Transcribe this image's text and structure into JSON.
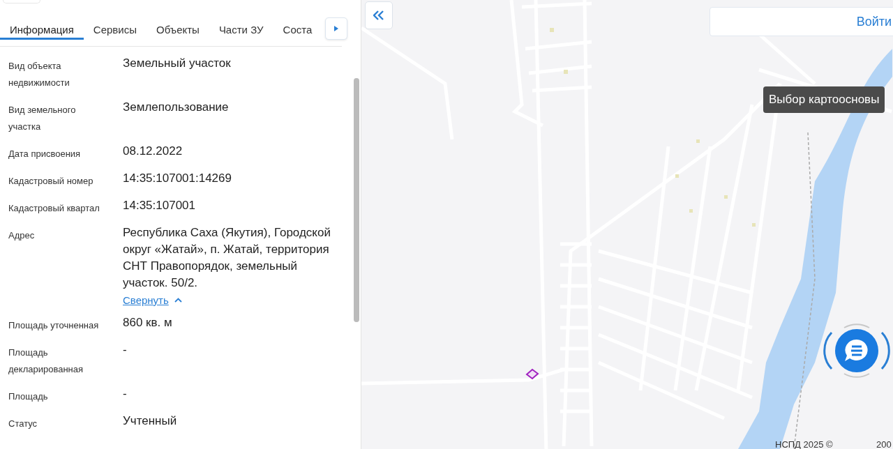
{
  "tabs": [
    {
      "label": "Информация",
      "selected": true
    },
    {
      "label": "Сервисы",
      "selected": false
    },
    {
      "label": "Объекты",
      "selected": false
    },
    {
      "label": "Части ЗУ",
      "selected": false
    },
    {
      "label": "Соста",
      "selected": false
    }
  ],
  "fields": [
    {
      "label": "Вид объекта недвижимости",
      "value": "Земельный участок"
    },
    {
      "label": "Вид земельного участка",
      "value": "Землепользование"
    },
    {
      "label": "Дата присвоения",
      "value": "08.12.2022"
    },
    {
      "label": "Кадастровый номер",
      "value": "14:35:107001:14269"
    },
    {
      "label": "Кадастровый квартал",
      "value": "14:35:107001"
    },
    {
      "label": "Адрес",
      "value": "Республика Саха (Якутия), Городской округ «Жатай», п. Жатай, территория СНТ Правопорядок, земельный участок. 50/2.",
      "link": "Свернуть"
    },
    {
      "label": "Площадь уточненная",
      "value": "860 кв. м"
    },
    {
      "label": "Площадь декларированная",
      "value": "-"
    },
    {
      "label": "Площадь",
      "value": "-"
    },
    {
      "label": "Статус",
      "value": "Учтенный"
    }
  ],
  "map": {
    "login": "Войти",
    "tooltip": "Выбор картоосновы",
    "attribution": "НСПД 2025 ©",
    "scale": "200"
  }
}
